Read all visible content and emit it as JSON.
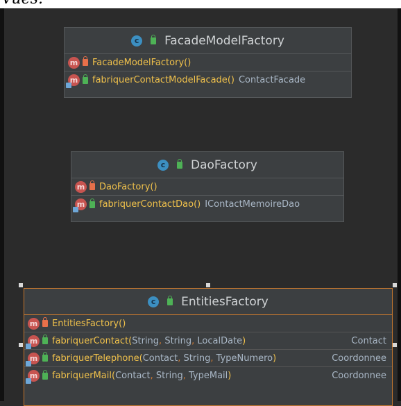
{
  "caption_fragment": "Vues.",
  "classes": [
    {
      "name": "FacadeModelFactory",
      "methods": [
        {
          "name": "FacadeModelFactory",
          "params": "",
          "return": "",
          "visibility": "private"
        },
        {
          "name": "fabriquerContactModelFacade",
          "params": "",
          "return": "ContactFacade",
          "visibility": "public"
        }
      ]
    },
    {
      "name": "DaoFactory",
      "methods": [
        {
          "name": "DaoFactory",
          "params": "",
          "return": "",
          "visibility": "private"
        },
        {
          "name": "fabriquerContactDao",
          "params": "",
          "return": "IContactMemoireDao",
          "visibility": "public"
        }
      ]
    },
    {
      "name": "EntitiesFactory",
      "methods": [
        {
          "name": "EntitiesFactory",
          "params": "",
          "return": "",
          "visibility": "private"
        },
        {
          "name": "fabriquerContact",
          "params": "String, String, LocalDate",
          "return": "Contact",
          "visibility": "public"
        },
        {
          "name": "fabriquerTelephone",
          "params": "Contact, String, TypeNumero",
          "return": "Coordonnee",
          "visibility": "public"
        },
        {
          "name": "fabriquerMail",
          "params": "Contact, String, TypeMail",
          "return": "Coordonnee",
          "visibility": "public"
        }
      ]
    }
  ],
  "icons": {
    "class": "class-icon",
    "method": "method-icon",
    "public": "public-lock-icon",
    "private": "private-lock-icon"
  },
  "colors": {
    "background": "#2b2b2b",
    "box": "#3c3f41",
    "method_name": "#f0c14b",
    "text": "#a9b7c6",
    "selected_border": "#c8792f"
  }
}
